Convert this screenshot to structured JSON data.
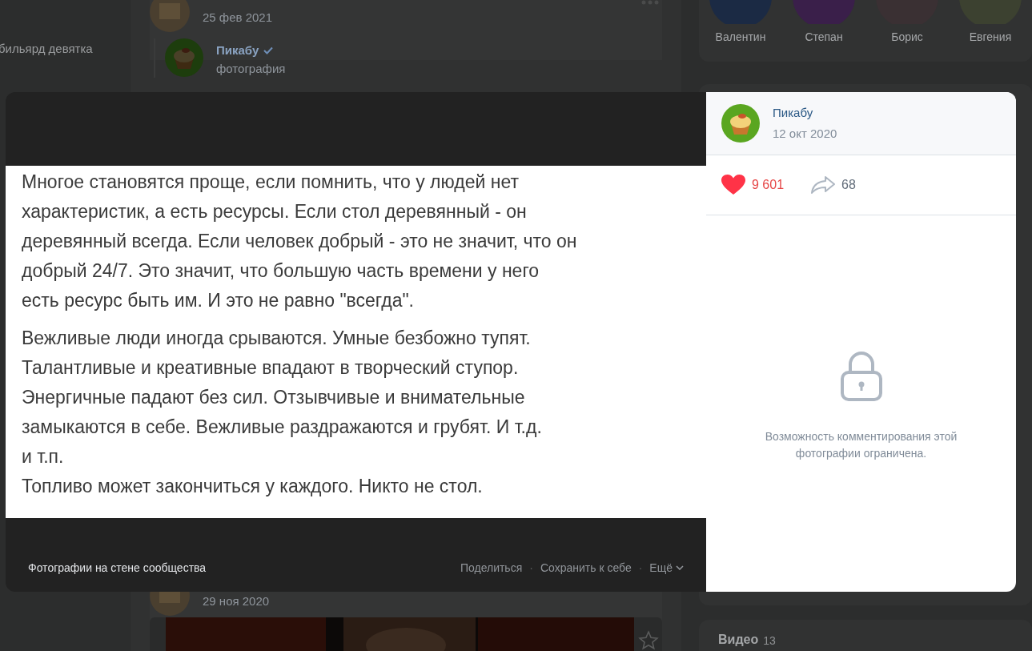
{
  "sidebar": {
    "items": [
      {
        "label": "бильярд девятка"
      }
    ]
  },
  "feed": {
    "posts": [
      {
        "date": "25 фев 2021",
        "repost": {
          "author": "Пикабу",
          "verified": true,
          "subtitle": "фотография"
        }
      },
      {
        "date": "29 ноя 2020"
      }
    ]
  },
  "friends": [
    {
      "name": "Валентин"
    },
    {
      "name": "Степан"
    },
    {
      "name": "Борис"
    },
    {
      "name": "Евгения"
    }
  ],
  "videos": {
    "title": "Видео",
    "count": "13"
  },
  "viewer": {
    "image_paragraphs": [
      [
        "Многое становятся проще, если помнить, что у людей нет",
        "характеристик, а есть ресурсы. Если стол деревянный - он",
        "деревянный всегда. Если человек добрый - это не значит, что он",
        "добрый 24/7. Это значит, что большую часть времени у него",
        "есть ресурс быть им. И это не равно \"всегда\"."
      ],
      [
        "Вежливые люди иногда срываются. Умные безбожно тупят.",
        "Талантливые и креативные впадают в творческий ступор.",
        "Энергичные падают без сил. Отзывчивые и внимательные",
        "замыкаются в себе. Вежливые раздражаются и грубят. И т.д.",
        "и т.п.",
        "Топливо может закончиться у каждого. Никто не стол."
      ]
    ],
    "album": "Фотографии на стене сообщества",
    "actions": [
      "Поделиться",
      "Сохранить к себе",
      "Ещё"
    ],
    "separator": "·",
    "author": "Пикабу",
    "date": "12 окт 2020",
    "likes": "9 601",
    "liked": true,
    "shares": "68",
    "comments_notice": "Возможность комментирования этой фотографии ограничена."
  }
}
